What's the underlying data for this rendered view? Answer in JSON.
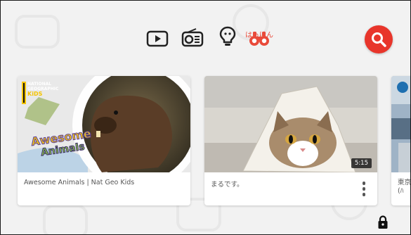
{
  "nav": {
    "categories": [
      {
        "icon": "tv-show-icon"
      },
      {
        "icon": "radio-music-icon"
      },
      {
        "icon": "lightbulb-learning-icon"
      },
      {
        "icon": "binoculars-explore-icon",
        "label": "はっけん",
        "active": true
      }
    ],
    "active_color": "#e94a3a"
  },
  "search": {
    "icon": "search-icon",
    "color": "#e8352b"
  },
  "videos": [
    {
      "title": "Awesome Animals | Nat Geo Kids",
      "channel_logo_lines": [
        "NATIONAL",
        "GEOGRAPHIC",
        "KiDS"
      ],
      "thumb_text_line1": "Awesome",
      "thumb_text_line2": "Animals"
    },
    {
      "title": "まるです。",
      "duration": "5:15"
    },
    {
      "title": "東京\n(ﾊ"
    }
  ],
  "lock": {
    "icon": "lock-icon"
  }
}
